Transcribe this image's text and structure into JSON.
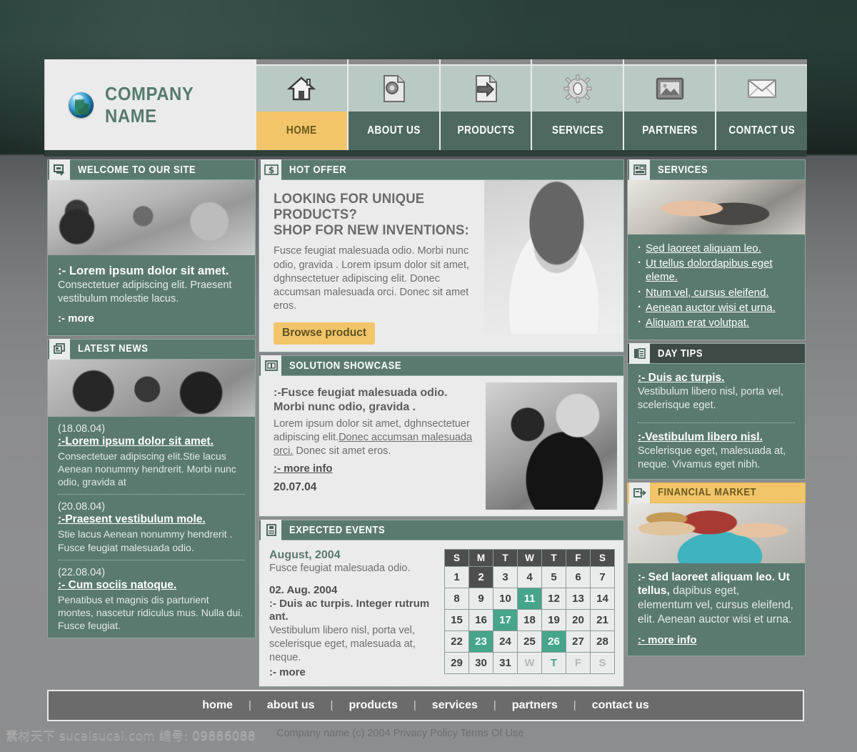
{
  "header": {
    "brand_name": "COMPANY NAME",
    "logo_icon": "globe-icon",
    "nav": [
      {
        "label": "HOME",
        "icon": "home-icon",
        "active": true
      },
      {
        "label": "ABOUT US",
        "icon": "document-icon",
        "active": false
      },
      {
        "label": "PRODUCTS",
        "icon": "arrow-page-icon",
        "active": false
      },
      {
        "label": "SERVICES",
        "icon": "gear-icon",
        "active": false
      },
      {
        "label": "PARTNERS",
        "icon": "picture-icon",
        "active": false
      },
      {
        "label": "CONTACT US",
        "icon": "envelope-icon",
        "active": false
      }
    ]
  },
  "welcome": {
    "title": "WELCOME TO OUR SITE",
    "icon": "screen-arrow-icon",
    "lede": ":- Lorem ipsum dolor sit amet.",
    "body": "Consectetuer adipiscing elit. Praesent vestibulum molestie lacus.",
    "more": ":- more"
  },
  "latest_news": {
    "title": "LATEST NEWS",
    "icon": "news-stack-icon",
    "items": [
      {
        "date": "(18.08.04)",
        "title": ":-Lorem ipsum dolor sit amet.",
        "text": "Consectetuer adipiscing elit.Stie lacus Aenean nonummy hendrerit. Morbi nunc odio, gravida at"
      },
      {
        "date": "(20.08.04)",
        "title": ":-Praesent vestibulum mole.",
        "text": "Stie lacus Aenean nonummy hendrerit . Fusce feugiat malesuada odio."
      },
      {
        "date": "(22.08.04)",
        "title": ":- Cum sociis natoque.",
        "text": "Penatibus et magnis dis parturient montes, nascetur ridiculus mus. Nulla dui. Fusce feugiat."
      }
    ]
  },
  "hot_offer": {
    "title": "HOT OFFER",
    "icon": "dollar-icon",
    "heading_line1": "LOOKING FOR UNIQUE PRODUCTS?",
    "heading_line2": "SHOP FOR NEW INVENTIONS:",
    "body": "Fusce feugiat malesuada odio. Morbi nunc odio, gravida . Lorem ipsum dolor sit amet, dghnsectetuer adipiscing elit. Donec accumsan malesuada orci. Donec sit amet eros.",
    "button": "Browse product",
    "photo": "woman-portrait-photo"
  },
  "solution_showcase": {
    "title": "SOLUTION SHOWCASE",
    "icon": "frame-icon",
    "heading": ":-Fusce feugiat malesuada odio. Morbi nunc odio, gravida .",
    "body_part1": "Lorem ipsum dolor sit amet, dghnsectetuer adipiscing elit.",
    "body_link": "Donec accumsan malesuada orci.",
    "body_part2": " Donec sit amet eros.",
    "more": ":- more info",
    "date": "20.07.04",
    "photo": "two-people-reading-photo"
  },
  "expected_events": {
    "title": "EXPECTED EVENTS",
    "icon": "calendar-page-icon",
    "month_label": "August, 2004",
    "month_sub": "Fusce feugiat malesuada odio.",
    "event_date": "02. Aug. 2004",
    "event_title": ":- Duis ac turpis. Integer rutrum ant.",
    "event_body": "Vestibulum libero nisl, porta vel, scelerisque eget, malesuada at, neque.",
    "more": ":- more",
    "calendar": {
      "weekdays": [
        "S",
        "M",
        "T",
        "W",
        "T",
        "F",
        "S"
      ],
      "weeks": [
        [
          {
            "d": "1"
          },
          {
            "d": "2",
            "state": "sel"
          },
          {
            "d": "3"
          },
          {
            "d": "4"
          },
          {
            "d": "5"
          },
          {
            "d": "6"
          },
          {
            "d": "7"
          }
        ],
        [
          {
            "d": "8"
          },
          {
            "d": "9"
          },
          {
            "d": "10"
          },
          {
            "d": "11",
            "state": "hi"
          },
          {
            "d": "12"
          },
          {
            "d": "13"
          },
          {
            "d": "14"
          }
        ],
        [
          {
            "d": "15"
          },
          {
            "d": "16"
          },
          {
            "d": "17",
            "state": "hi"
          },
          {
            "d": "18"
          },
          {
            "d": "19"
          },
          {
            "d": "20"
          },
          {
            "d": "21"
          }
        ],
        [
          {
            "d": "22"
          },
          {
            "d": "23",
            "state": "hi"
          },
          {
            "d": "24"
          },
          {
            "d": "25"
          },
          {
            "d": "26",
            "state": "hi"
          },
          {
            "d": "27"
          },
          {
            "d": "28"
          }
        ],
        [
          {
            "d": "29"
          },
          {
            "d": "30"
          },
          {
            "d": "31"
          },
          {
            "d": "W",
            "state": "muted"
          },
          {
            "d": "T",
            "state": "muted-t"
          },
          {
            "d": "F",
            "state": "muted"
          },
          {
            "d": "S",
            "state": "muted"
          }
        ]
      ]
    }
  },
  "services": {
    "title": "SERVICES",
    "icon": "layout-blocks-icon",
    "photo": "hands-on-keyboard-photo",
    "items": [
      "Sed laoreet aliquam leo.",
      "Ut tellus dolordapibus eget eleme.",
      "Ntum vel, cursus eleifend.",
      "Aenean auctor wisi et urna.",
      "Aliquam erat volutpat."
    ]
  },
  "day_tips": {
    "title": "DAY TIPS",
    "icon": "book-page-icon",
    "tips": [
      {
        "title": ":- Duis ac turpis.",
        "body": "Vestibulum libero nisl, porta vel,  scelerisque eget."
      },
      {
        "title": ":-Vestibulum libero nisl.",
        "body": "Scelerisque eget, malesuada at, neque. Vivamus eget nibh."
      }
    ]
  },
  "financial_market": {
    "title": "FINANCIAL MARKET",
    "icon": "export-box-icon",
    "photo": "business-people-photo",
    "lede_bold": ":- Sed laoreet aliquam leo. Ut tellus,",
    "lede_rest": " dapibus eget, elementum vel, cursus eleifend, elit. Aenean auctor wisi et urna.",
    "more": ":- more info"
  },
  "footer": {
    "links": [
      "home",
      "about us",
      "products",
      "services",
      "partners",
      "contact us"
    ],
    "divider": "|",
    "copyright": "Company name (c) 2004 Privacy Policy  Terms Of Use"
  },
  "watermark": {
    "text": "素材天下 sucaisucai.com  编号:",
    "number": "09886088"
  }
}
